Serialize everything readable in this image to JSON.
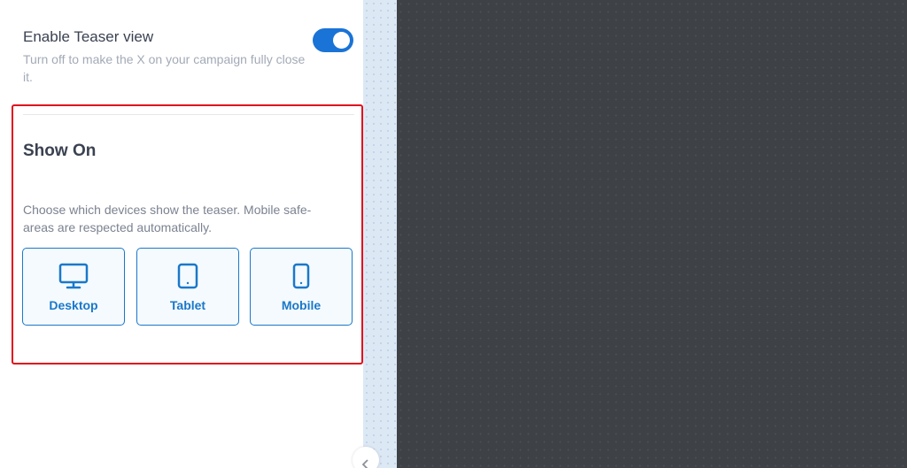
{
  "teaser": {
    "title": "Enable Teaser view",
    "description": "Turn off to make the X on your campaign fully close it.",
    "enabled": true
  },
  "show_on": {
    "title": "Show On",
    "description": "Choose which devices show the teaser. Mobile safe-areas are respected automatically.",
    "devices": [
      {
        "label": "Desktop",
        "icon": "desktop-icon"
      },
      {
        "label": "Tablet",
        "icon": "tablet-icon"
      },
      {
        "label": "Mobile",
        "icon": "mobile-icon"
      }
    ]
  },
  "colors": {
    "accent": "#1a78c9",
    "toggle_on": "#1a73d6",
    "highlight": "#e0101e",
    "canvas": "#3e4146"
  }
}
